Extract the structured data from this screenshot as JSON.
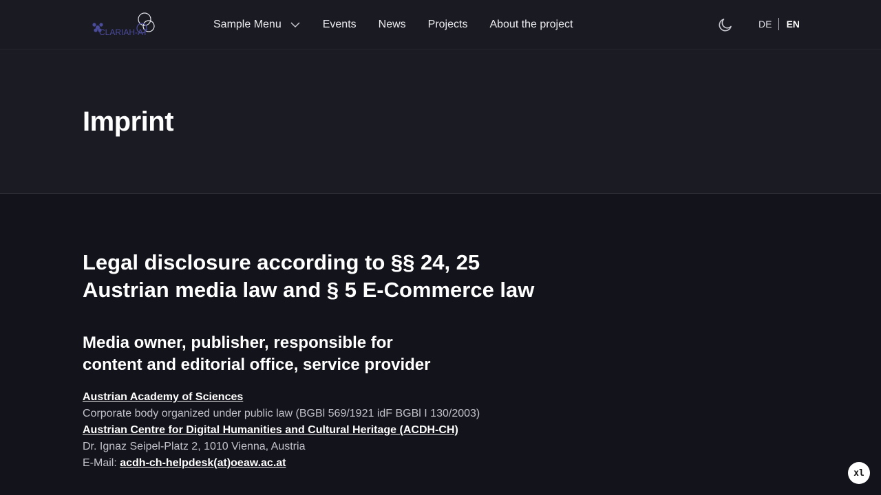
{
  "header": {
    "logo_text": "CLARIAH-AT",
    "nav": [
      {
        "label": "Sample Menu",
        "has_dropdown": true
      },
      {
        "label": "Events"
      },
      {
        "label": "News"
      },
      {
        "label": "Projects"
      },
      {
        "label": "About the project"
      }
    ],
    "theme_icon": "moon-icon",
    "languages": {
      "de": "DE",
      "en": "EN",
      "active": "EN"
    }
  },
  "hero": {
    "title": "Imprint"
  },
  "content": {
    "heading": "Legal disclosure according to §§ 24, 25 Austrian media law and § 5 E-Commerce law",
    "subheading": "Media owner, publisher, responsible for content and editorial office, service provider",
    "org_link": "Austrian Academy of Sciences",
    "org_description": "Corporate body organized under public law (BGBl 569/1921 idF BGBl I 130/2003)",
    "centre_link": "Austrian Centre for Digital Humanities and Cultural Heritage (ACDH-CH)",
    "address": "Dr. Ignaz Seipel-Platz 2, 1010 Vienna, Austria",
    "email_label": "E-Mail: ",
    "email": "acdh-ch-helpdesk(at)oeaw.ac.at"
  },
  "badge": {
    "label": "xl"
  },
  "colors": {
    "background": "#13131b",
    "header": "#1a1a23",
    "hero": "#1b1b24",
    "text": "#ffffff",
    "muted": "#c2c2ca",
    "logo_accent": "#4b4b9c"
  }
}
